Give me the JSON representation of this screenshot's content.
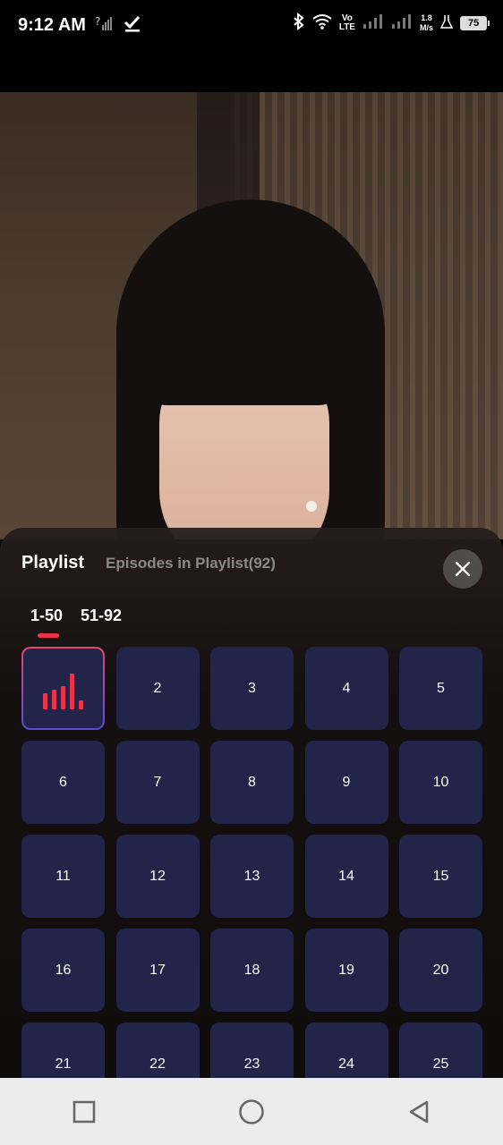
{
  "status_bar": {
    "time": "9:12 AM",
    "network_speed_value": "1.8",
    "network_speed_unit": "M/s",
    "volte_top": "Vo",
    "volte_bottom": "LTE",
    "battery": "75"
  },
  "playlist": {
    "title": "Playlist",
    "subtitle": "Episodes in Playlist(92)",
    "tabs": [
      {
        "label": "1-50",
        "active": true
      },
      {
        "label": "51-92",
        "active": false
      }
    ],
    "current_episode": 1,
    "episodes": [
      "1",
      "2",
      "3",
      "4",
      "5",
      "6",
      "7",
      "8",
      "9",
      "10",
      "11",
      "12",
      "13",
      "14",
      "15",
      "16",
      "17",
      "18",
      "19",
      "20",
      "21",
      "22",
      "23",
      "24",
      "25"
    ]
  },
  "colors": {
    "accent": "#e8334a",
    "cell_bg": "#22244a",
    "nav_bg": "#ececec"
  }
}
